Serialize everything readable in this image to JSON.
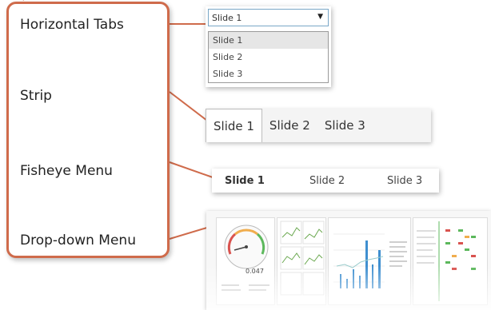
{
  "nav_types": {
    "items": [
      "Horizontal Tabs",
      "Strip",
      "Fisheye Menu",
      "Drop-down Menu"
    ]
  },
  "dropdown_menu": {
    "selected": "Slide 1",
    "options": [
      "Slide 1",
      "Slide 2",
      "Slide 3"
    ]
  },
  "strip": {
    "tabs": [
      "Slide 1",
      "Slide 2",
      "Slide 3"
    ]
  },
  "fisheye": {
    "items": [
      "Slide 1",
      "Slide 2",
      "Slide 3"
    ]
  },
  "dashboard": {
    "gauge_value": "0.047"
  },
  "colors": {
    "accent": "#cf6b4b",
    "select_border": "#7aa7c7",
    "bar_blue": "#3f8fd0",
    "gauge_red": "#d9534f",
    "gauge_green": "#5cb85c"
  }
}
